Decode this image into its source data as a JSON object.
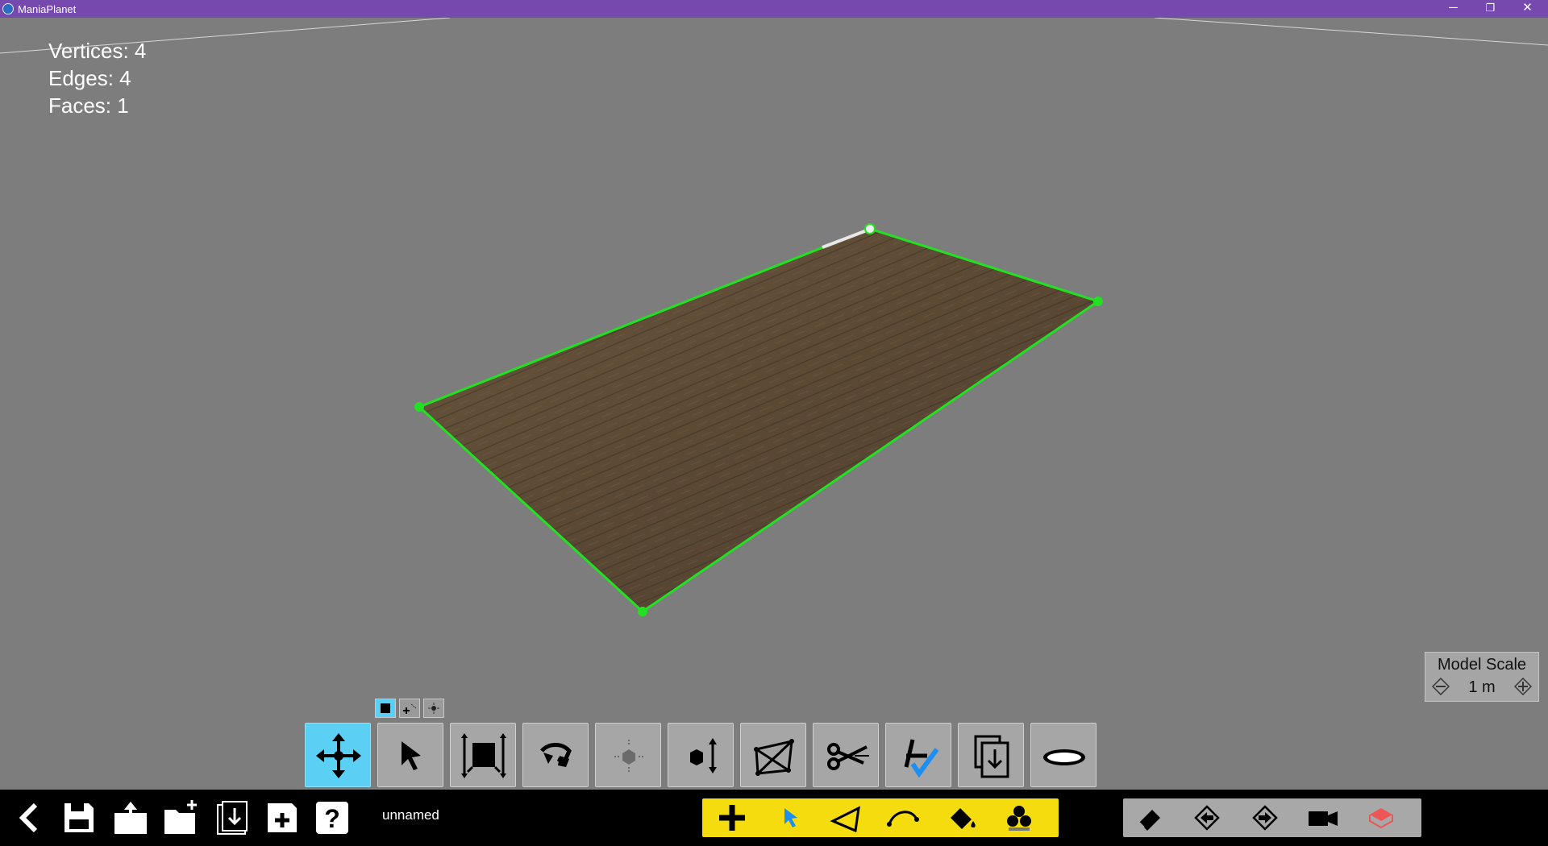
{
  "window": {
    "title": "ManiaPlanet",
    "minimize_glyph": "─",
    "restore_glyph": "❐",
    "close_glyph": "✕"
  },
  "stats": {
    "vertices": "Vertices: 4",
    "edges": "Edges: 4",
    "faces": "Faces: 1"
  },
  "selection_modes": [
    {
      "name": "face-mode",
      "active": true
    },
    {
      "name": "edge-mode",
      "active": false
    },
    {
      "name": "vertex-mode",
      "active": false
    }
  ],
  "tools": [
    {
      "name": "move-tool",
      "icon": "move-arrows-icon",
      "active": true
    },
    {
      "name": "select-tool",
      "icon": "cursor-arrow-icon"
    },
    {
      "name": "scale-tool",
      "icon": "scale-frame-icon"
    },
    {
      "name": "rotate-tool",
      "icon": "rotate-icon"
    },
    {
      "name": "center-tool",
      "icon": "center-pivot-icon",
      "disabled": true
    },
    {
      "name": "extrude-tool",
      "icon": "extrude-icon"
    },
    {
      "name": "triangulate-tool",
      "icon": "triangulate-icon"
    },
    {
      "name": "cut-tool",
      "icon": "scissors-icon"
    },
    {
      "name": "merge-tool",
      "icon": "merge-check-icon"
    },
    {
      "name": "paste-tool",
      "icon": "paste-icon"
    },
    {
      "name": "ellipse-tool",
      "icon": "ellipse-icon"
    }
  ],
  "model_scale": {
    "label": "Model Scale",
    "value": "1 m"
  },
  "bottom": {
    "filename": "unnamed",
    "file_buttons": [
      "back-icon",
      "save-icon",
      "upload-icon",
      "new-folder-icon",
      "import-icon",
      "save-as-icon",
      "help-icon"
    ],
    "create_tools": [
      "add-icon",
      "select-icon",
      "polygon-icon",
      "curve-icon",
      "paint-bucket-icon",
      "group-icon"
    ],
    "view_tools": [
      "eraser-icon",
      "undo-icon",
      "redo-icon",
      "camera-icon",
      "hide-cube-icon"
    ]
  },
  "colors": {
    "titlebar": "#7549ae",
    "viewport": "#7d7d7d",
    "selection_edge": "#22e022",
    "active_tool": "#5bd0f4",
    "create_bar": "#f4dc0f"
  }
}
